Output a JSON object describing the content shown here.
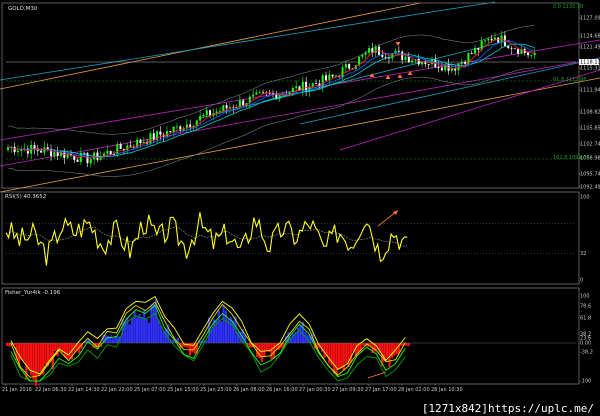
{
  "colors": {
    "background": "#000000",
    "frame": "#9a9a9a",
    "grid": "#2a2a2a",
    "bull": "#19ff19",
    "bear": "#ffffff",
    "ma_fast": "#ff2020",
    "ma_mid": "#0066ff",
    "ma_slow": "#00d1d1",
    "band": "#6d7a86",
    "chan_outer": "#e8a040",
    "chan_mid": "#c020c0",
    "chan_inner": "#1fa0c0",
    "rsi": "#ffff1a",
    "hist_pos": "#3030ff",
    "hist_neg": "#ff1010",
    "arrow": "#ff7038",
    "fisher_1": "#ffff1a",
    "fisher_2": "#19ff19",
    "fisher_3": "#00a000",
    "fisher_4": "#e0e000"
  },
  "main": {
    "title": "GOLD,M30",
    "price_ticks": [
      "1127.09",
      "1124.68",
      "1121.49",
      "1118.43",
      "1115.31",
      "1111.94",
      "1108.82",
      "1105.85",
      "1102.74",
      "1098.98",
      "1095.74",
      "1092.49"
    ],
    "current_price": "1118.13",
    "fib_top": "0.0 1130.18",
    "fib_mid": "61.8 1112.88",
    "fib_low": "161.8 1099.33"
  },
  "rsi": {
    "title": "RSI(5) 40.3652",
    "ticks": [
      "100",
      "32",
      "0"
    ]
  },
  "fisher": {
    "title": "Fisher_Yur4ik -0.196",
    "ticks": [
      "100",
      "78.6",
      "61.8",
      "38.2",
      "23.6",
      "0.00",
      "-38.2",
      "-100"
    ]
  },
  "time_labels": [
    "21 Jan 2016",
    "22 Jan 06:30",
    "22 Jan 14:30",
    "22 Jan 22:00",
    "25 Jan 07:00",
    "25 Jan 15:00",
    "25 Jan 23:00",
    "26 Jan 08:00",
    "26 Jan 16:00",
    "27 Jan 00:30",
    "27 Jan 09:30",
    "27 Jan 17:00",
    "28 Jan 02:00",
    "28 Jan 10:30"
  ],
  "watermark": "[1271x842]https://uplc.me/",
  "chart_data": [
    {
      "type": "line",
      "title": "GOLD,M30",
      "x": [
        "21 Jan 2016",
        "22 Jan 06:30",
        "22 Jan 14:30",
        "22 Jan 22:00",
        "25 Jan 07:00",
        "25 Jan 15:00",
        "25 Jan 23:00",
        "26 Jan 08:00",
        "26 Jan 16:00",
        "27 Jan 00:30",
        "27 Jan 09:30",
        "27 Jan 17:00",
        "28 Jan 02:00",
        "28 Jan 10:30"
      ],
      "series": [
        {
          "values": [
            1100.2,
            1099.5,
            1097.8,
            1100.6,
            1103.4,
            1106.9,
            1109.8,
            1111.5,
            1114.0,
            1119.6,
            1117.9,
            1116.1,
            1122.4,
            1118.1
          ]
        }
      ],
      "ylim": [
        1092.49,
        1128.5
      ],
      "grid": false
    },
    {
      "type": "line",
      "title": "RSI(5) 40.3652",
      "series": [
        {
          "values": [
            62,
            48,
            55,
            30,
            66,
            58,
            70,
            42,
            60,
            35,
            72,
            50,
            64,
            38,
            68,
            45,
            57,
            32,
            76,
            40,
            63,
            52,
            70,
            36,
            60,
            44,
            80,
            33,
            59,
            40
          ]
        }
      ],
      "ylim": [
        0,
        100
      ],
      "reference_lines": [
        32
      ]
    },
    {
      "type": "bar",
      "title": "Fisher_Yur4ik -0.196",
      "values": [
        -0.2,
        -1.5,
        -2.2,
        -2.4,
        -1.6,
        -0.8,
        -1.1,
        -0.6,
        0.2,
        -0.3,
        0.5,
        0.4,
        1.6,
        2.3,
        1.9,
        2.5,
        1.1,
        0.3,
        -0.4,
        -0.7,
        0.2,
        1.4,
        2.2,
        1.7,
        0.8,
        -0.3,
        -1.2,
        -0.9,
        -0.4,
        0.6,
        1.2,
        0.7,
        -0.5,
        -1.4,
        -2.0,
        -1.6,
        -0.8,
        -0.2,
        -0.6,
        -1.5,
        -1.1,
        -0.196
      ],
      "ylim": [
        -2.8,
        2.8
      ]
    }
  ]
}
